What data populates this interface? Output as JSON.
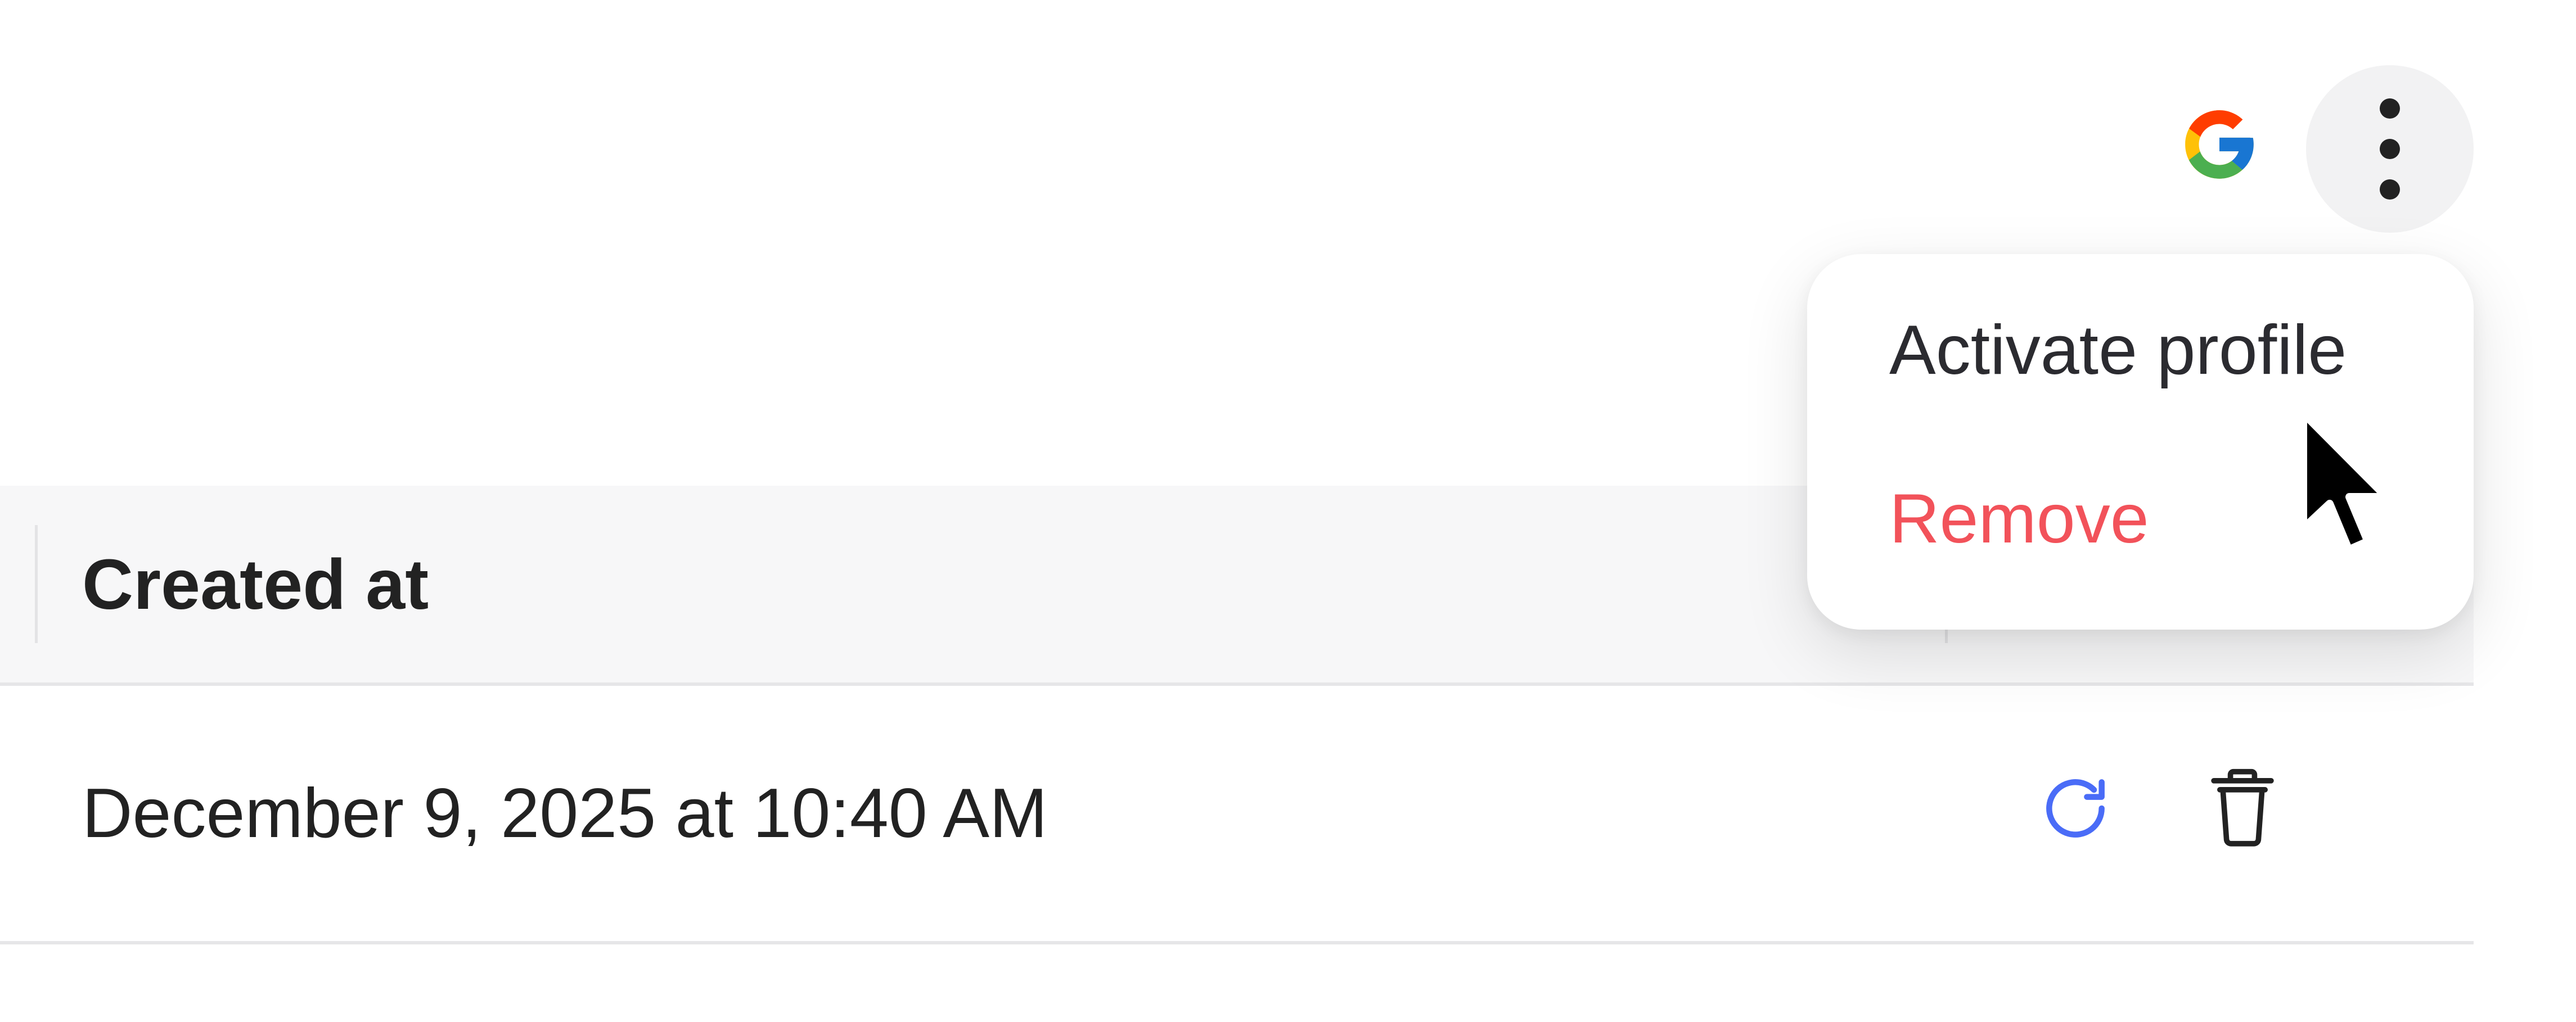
{
  "header": {
    "provider_icon": "google-logo-icon",
    "menu_icon": "more-vertical-icon"
  },
  "table": {
    "columns": [
      {
        "label": "Created at"
      }
    ],
    "rows": [
      {
        "created_at": "December 9, 2025 at 10:40 AM",
        "actions": [
          "refresh-icon",
          "trash-icon"
        ]
      }
    ]
  },
  "menu": {
    "items": [
      {
        "label": "Activate profile",
        "color": "#2b2b30"
      },
      {
        "label": "Remove",
        "color": "#f2525a"
      }
    ]
  },
  "colors": {
    "accent_blue": "#4a6cf7",
    "danger_red": "#f2525a",
    "header_bg": "#f7f7f8",
    "kebab_bg": "#f2f2f3"
  }
}
